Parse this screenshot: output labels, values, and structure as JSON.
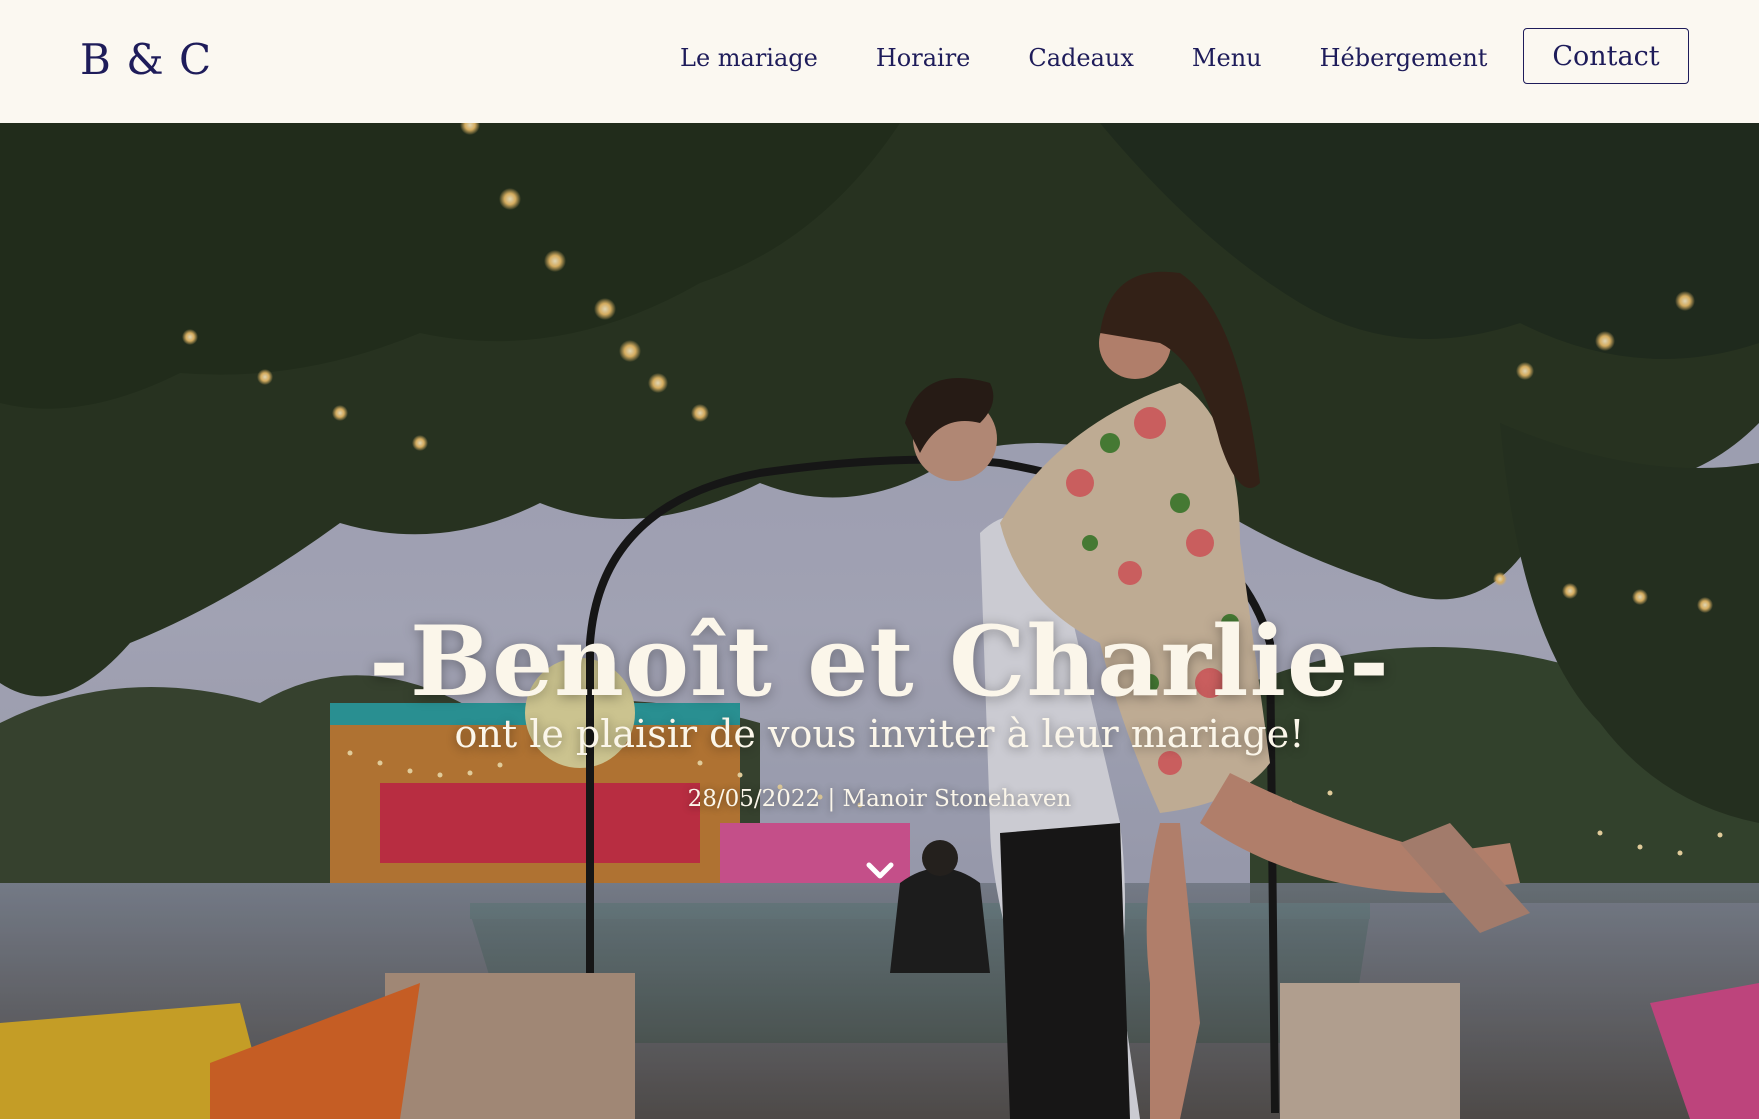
{
  "nav": {
    "logo": "B & C",
    "items": [
      {
        "label": "Le mariage"
      },
      {
        "label": "Horaire"
      },
      {
        "label": "Cadeaux"
      },
      {
        "label": "Menu"
      },
      {
        "label": "Hébergement"
      }
    ],
    "contact_label": "Contact"
  },
  "hero": {
    "title": "-Benoît et Charlie-",
    "subtitle": "ont le plaisir de vous inviter à leur mariage!",
    "date_location": "28/05/2022 | Manoir Stonehaven",
    "scroll_icon": "chevron-down-icon"
  },
  "colors": {
    "nav_background": "#fbf8f1",
    "brand_text": "#1e1c5a",
    "hero_text": "#fbf6ea"
  }
}
